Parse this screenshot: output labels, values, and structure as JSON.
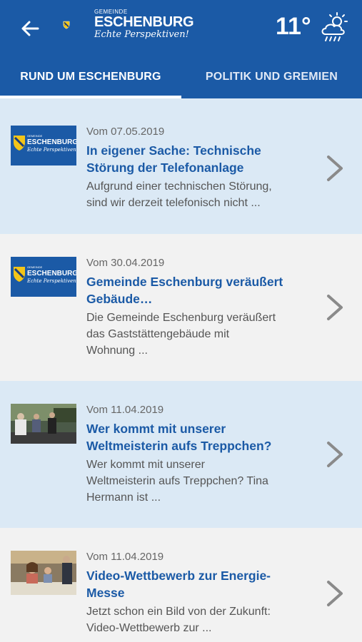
{
  "header": {
    "logo_small": "GEMEINDE",
    "logo_name": "ESCHENBURG",
    "logo_slogan": "Echte Perspektiven!",
    "temperature": "11°",
    "weather_icon": "cloud-sun-rain-icon",
    "back_icon": "arrow-left-icon",
    "background": "#1b5aa6"
  },
  "tabs": [
    {
      "label": "RUND UM ESCHENBURG",
      "active": true
    },
    {
      "label": "POLITIK UND GREMIEN",
      "active": false
    }
  ],
  "articles": [
    {
      "date": "Vom 07.05.2019",
      "title_lines": [
        "In eigener Sache: Technische",
        "Störung der Telefonanlage"
      ],
      "excerpt_lines": [
        "Aufgrund einer technischen Störung,",
        "sind wir derzeit telefonisch nicht ..."
      ],
      "thumb": "logo"
    },
    {
      "date": "Vom 30.04.2019",
      "title_lines": [
        "Gemeinde Eschenburg veräußert",
        "Gebäude…"
      ],
      "excerpt_lines": [
        "Die Gemeinde Eschenburg veräußert",
        "das Gaststättengebäude mit",
        "Wohnung ..."
      ],
      "thumb": "logo"
    },
    {
      "date": "Vom 11.04.2019",
      "title_lines": [
        "Wer kommt mit unserer",
        "Weltmeisterin aufs Treppchen?"
      ],
      "excerpt_lines": [
        "Wer kommt mit unserer",
        "Weltmeisterin aufs Treppchen? Tina",
        "Hermann ist ..."
      ],
      "thumb": "photo"
    },
    {
      "date": "Vom 11.04.2019",
      "title_lines": [
        "Video-Wettbewerb zur Energie-",
        "Messe"
      ],
      "excerpt_lines": [
        "Jetzt schon ein Bild von der Zukunft:",
        "Video-Wettbewerb zur ..."
      ],
      "thumb": "photo"
    }
  ]
}
